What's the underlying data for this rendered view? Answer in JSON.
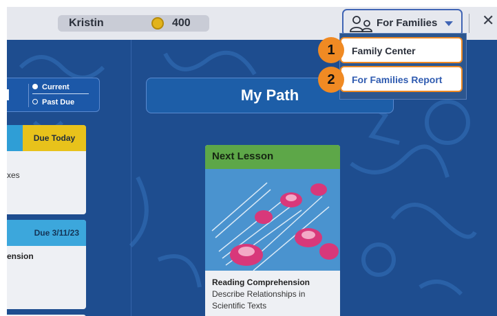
{
  "header": {
    "user_name": "Kristin",
    "coins": "400",
    "families_label": "For Families",
    "icons": {
      "coin": "coin-icon",
      "family": "family-icon",
      "caret": "caret-down-icon",
      "close": "close-icon"
    }
  },
  "menu": {
    "items": [
      {
        "number": "1",
        "label": "Family Center"
      },
      {
        "number": "2",
        "label": "For Families Report"
      }
    ]
  },
  "filter": {
    "title_fragment": "d",
    "options": [
      {
        "label": "Current",
        "selected": true
      },
      {
        "label": "Past Due",
        "selected": false
      }
    ]
  },
  "assignments": [
    {
      "due": "Due Today",
      "text": "xes"
    },
    {
      "due": "Due 3/11/23",
      "text": "ension"
    }
  ],
  "path": {
    "title": "My Path"
  },
  "lesson": {
    "header": "Next Lesson",
    "subject": "Reading Comprehension",
    "description": "Describe Relationships in Scientific Texts"
  },
  "colors": {
    "accent_orange": "#f08a23",
    "background_blue": "#1e4d8f",
    "lesson_green": "#5da748",
    "due_yellow": "#e8c21b"
  }
}
